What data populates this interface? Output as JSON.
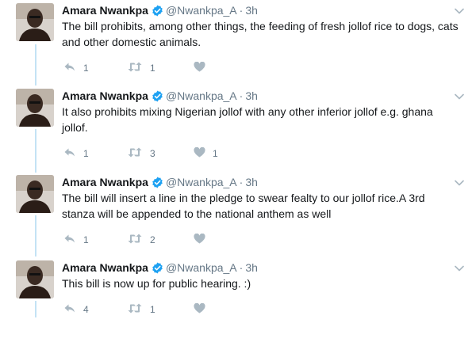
{
  "colors": {
    "verified": "#1da1f2",
    "thread_line": "#c4e3f5",
    "action_icon": "#aab8c2",
    "muted_text": "#657786"
  },
  "tweets": [
    {
      "name": "Amara Nwankpa",
      "handle": "@Nwankpa_A",
      "time": "3h",
      "text": "The bill prohibits, among other things, the feeding of fresh jollof rice to dogs, cats and other domestic animals.",
      "replies": "1",
      "retweets": "1",
      "likes": ""
    },
    {
      "name": "Amara Nwankpa",
      "handle": "@Nwankpa_A",
      "time": "3h",
      "text": "It also prohibits mixing Nigerian jollof with any other inferior jollof e.g. ghana jollof.",
      "replies": "1",
      "retweets": "3",
      "likes": "1"
    },
    {
      "name": "Amara Nwankpa",
      "handle": "@Nwankpa_A",
      "time": "3h",
      "text": "The bill will insert a line in the pledge to swear fealty to our jollof rice.A 3rd stanza will be appended to the national anthem as well",
      "replies": "1",
      "retweets": "2",
      "likes": ""
    },
    {
      "name": "Amara Nwankpa",
      "handle": "@Nwankpa_A",
      "time": "3h",
      "text": "This bill is now up for public hearing. :)",
      "replies": "4",
      "retweets": "1",
      "likes": ""
    }
  ]
}
